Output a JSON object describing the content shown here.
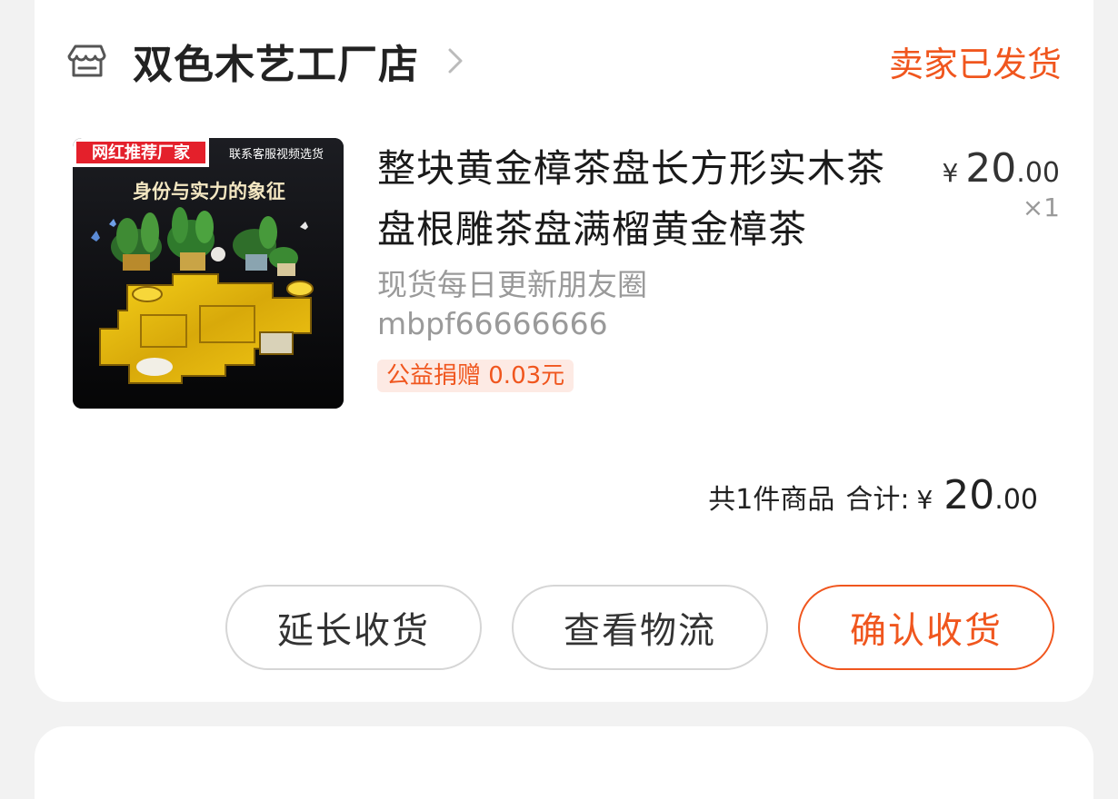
{
  "store": {
    "name": "双色木艺工厂店",
    "status": "卖家已发货"
  },
  "product": {
    "image_badge": "网红推荐厂家",
    "image_top_text": "联系客服视频选货",
    "image_slogan": "身份与实力的象征",
    "title": "整块黄金樟茶盘长方形实木茶盘根雕茶盘满榴黄金樟茶",
    "spec_line1": "现货每日更新朋友圈",
    "spec_line2": "mbpf66666666",
    "charity": "公益捐赠 0.03元",
    "price_currency": "¥",
    "price_int": "20",
    "price_dec": ".00",
    "quantity": "×1"
  },
  "summary": {
    "count_text": "共1件商品",
    "total_label": "合计:",
    "currency": "¥",
    "total_int": "20",
    "total_dec": ".00"
  },
  "actions": {
    "extend": "延长收货",
    "logistics": "查看物流",
    "confirm": "确认收货"
  },
  "colors": {
    "accent": "#f0561e",
    "background": "#f2f2f2",
    "card": "#ffffff"
  }
}
